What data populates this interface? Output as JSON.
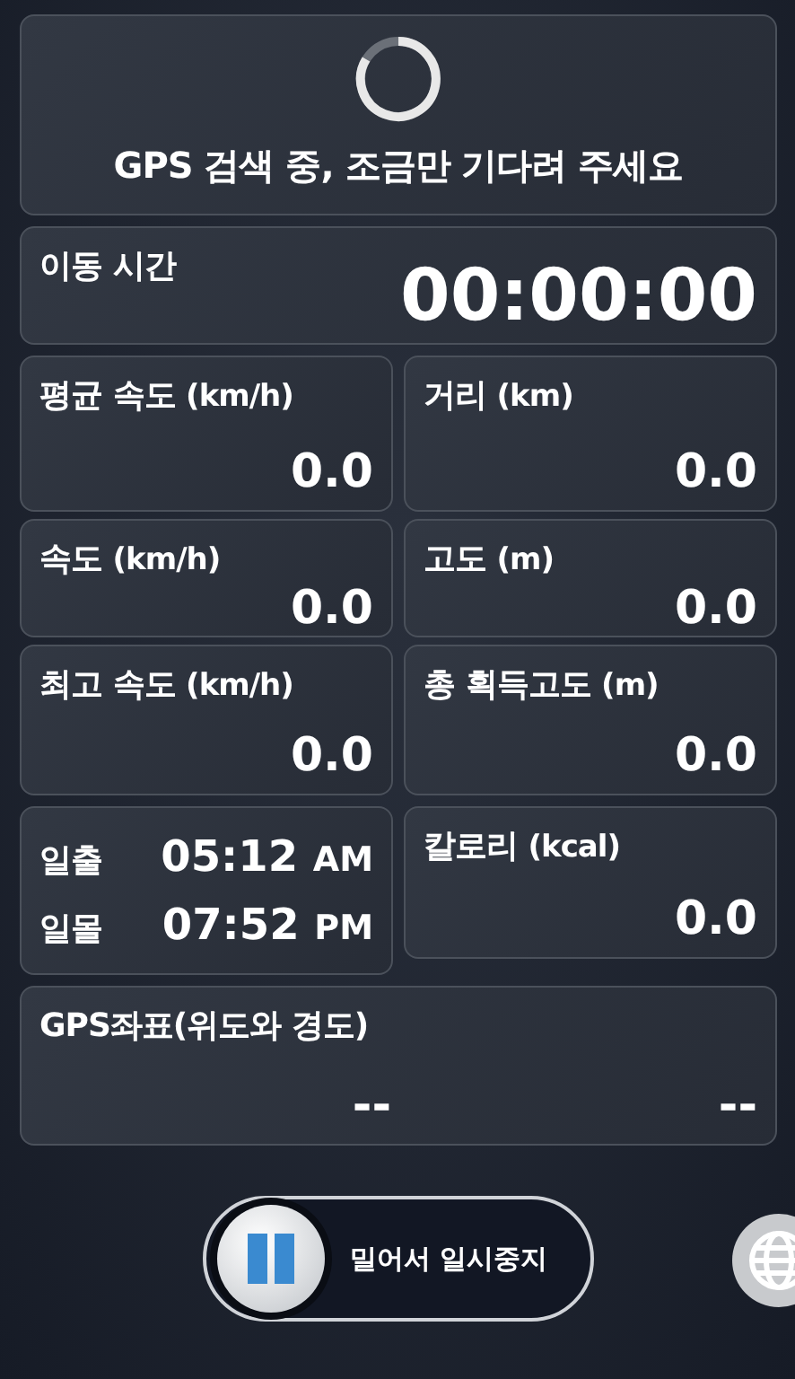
{
  "status": {
    "message": "GPS 검색 중, 조금만 기다려 주세요"
  },
  "moving_time": {
    "label": "이동 시간",
    "value": "00:00:00"
  },
  "stats": [
    {
      "label": "평균 속도",
      "unit": "(km/h)",
      "value": "0.0"
    },
    {
      "label": "거리",
      "unit": "(km)",
      "value": "0.0"
    },
    {
      "label": "속도",
      "unit": "(km/h)",
      "value": "0.0"
    },
    {
      "label": "고도",
      "unit": "(m)",
      "value": "0.0"
    },
    {
      "label": "최고 속도",
      "unit": "(km/h)",
      "value": "0.0"
    },
    {
      "label": "총 획득고도",
      "unit": "(m)",
      "value": "0.0"
    }
  ],
  "sun": [
    {
      "label": "일출",
      "time": "05:12",
      "ampm": "AM"
    },
    {
      "label": "일몰",
      "time": "07:52",
      "ampm": "PM"
    }
  ],
  "calories": {
    "label": "칼로리",
    "unit": "(kcal)",
    "value": "0.0"
  },
  "gps": {
    "label": "GPS좌표(위도와 경도)",
    "latitude": "--",
    "longitude": "--"
  },
  "slider": {
    "label": "밀어서 일시중지",
    "level": 0
  }
}
